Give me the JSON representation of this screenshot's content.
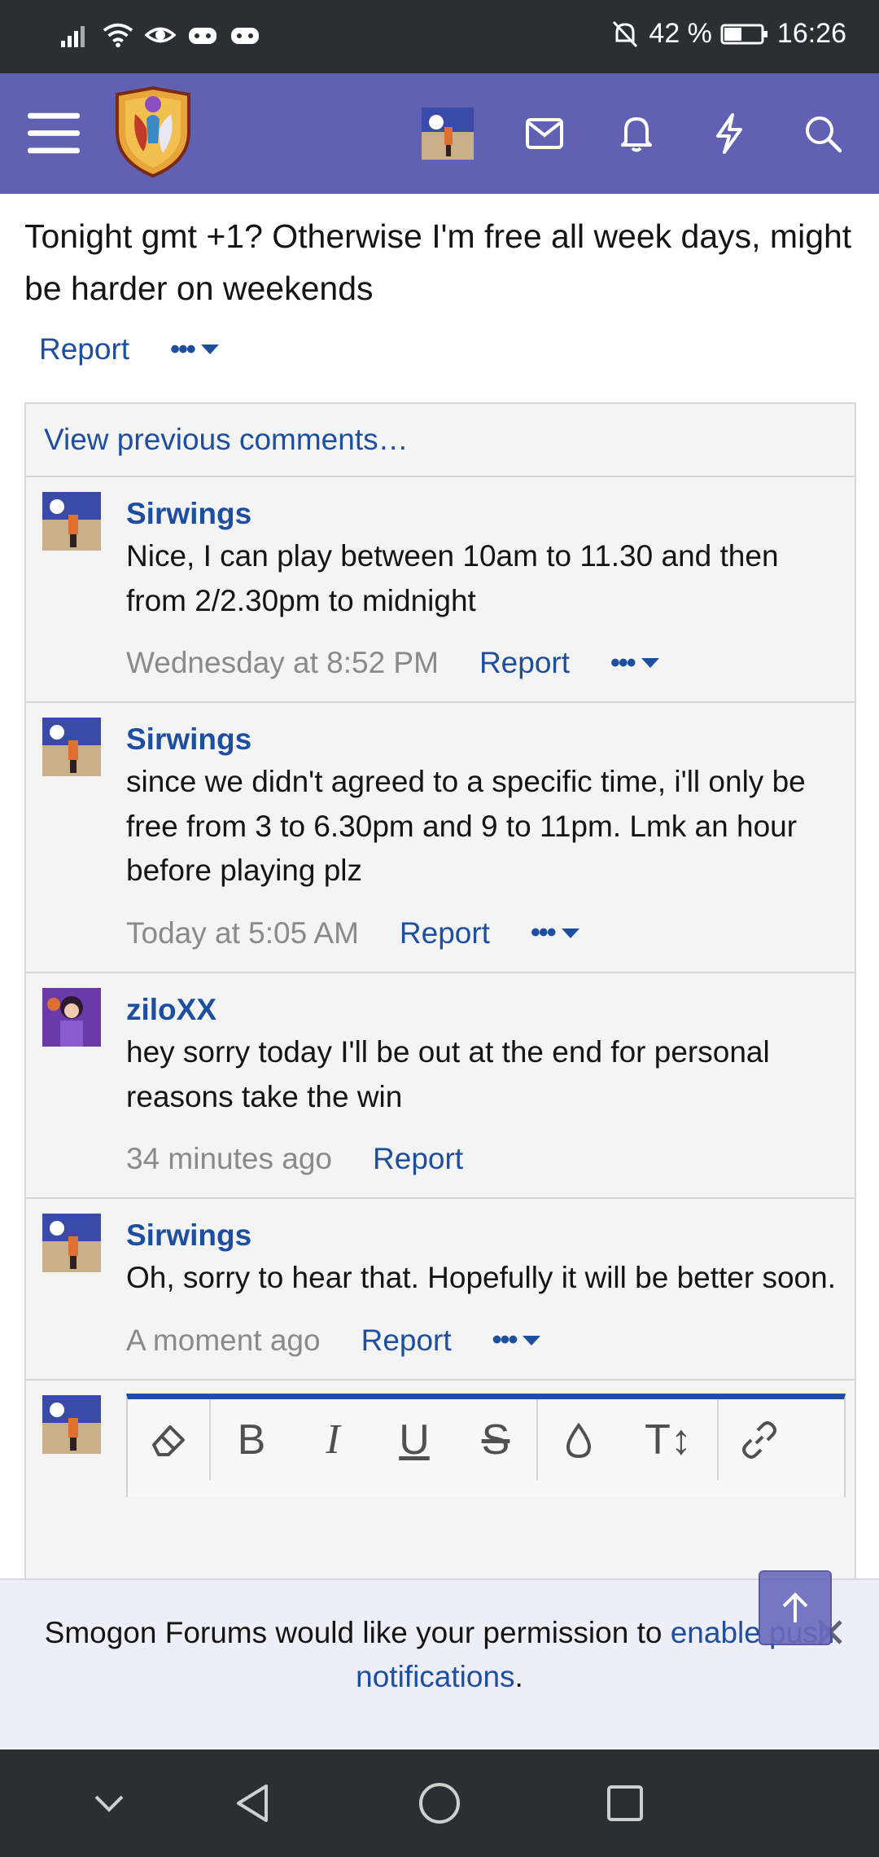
{
  "status_bar": {
    "battery": "42 %",
    "time": "16:26"
  },
  "post": {
    "text": "Tonight gmt +1? Otherwise I'm free all week days, might be harder on weekends",
    "report_label": "Report",
    "more_label": "•••"
  },
  "comments_panel": {
    "view_previous": "View previous comments…",
    "items": [
      {
        "author": "Sirwings",
        "text": "Nice, I can play between 10am to 11.30 and then from 2/2.30pm to midnight",
        "time": "Wednesday at 8:52 PM",
        "report": "Report",
        "more": "•••"
      },
      {
        "author": "Sirwings",
        "text": "since we didn't agreed to a specific time, i'll only be free from 3 to 6.30pm and 9 to 11pm. Lmk an hour before playing plz",
        "time": "Today at 5:05 AM",
        "report": "Report",
        "more": "•••"
      },
      {
        "author": "ziloXX",
        "text": "hey sorry today I'll be out at the end for personal reasons take the win",
        "time": "34 minutes ago",
        "report": "Report"
      },
      {
        "author": "Sirwings",
        "text": "Oh, sorry to hear that. Hopefully it will be better soon.",
        "time": "A moment ago",
        "report": "Report",
        "more": "•••"
      }
    ]
  },
  "editor_toolbar": {
    "bold": "B",
    "italic": "I",
    "underline": "U",
    "strike": "S",
    "text_size": "T↕"
  },
  "notification": {
    "text": "Smogon Forums would like your permission to ",
    "link": "enable push notifications",
    "suffix": "."
  },
  "colors": {
    "nav_bg": "#6161b4",
    "link": "#1d4ea0",
    "status_bar": "#2b2e33"
  }
}
